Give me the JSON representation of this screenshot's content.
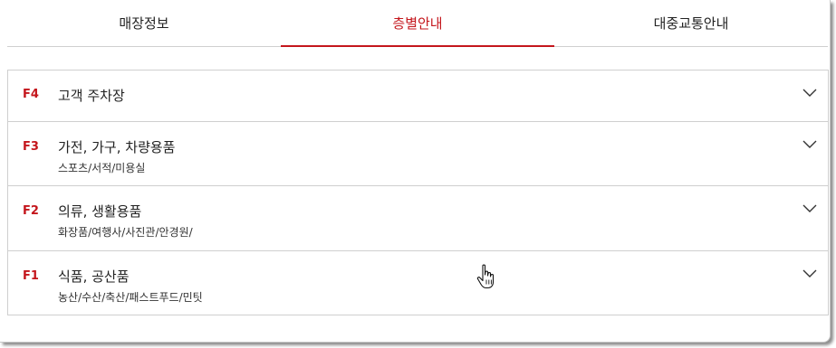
{
  "tabs": [
    {
      "label": "매장정보",
      "active": false
    },
    {
      "label": "층별안내",
      "active": true
    },
    {
      "label": "대중교통안내",
      "active": false
    }
  ],
  "accent_color": "#c4161c",
  "floors": [
    {
      "code": "F4",
      "title": "고객 주차장",
      "sub": ""
    },
    {
      "code": "F3",
      "title": "가전, 가구, 차량용품",
      "sub": "스포츠/서적/미용실"
    },
    {
      "code": "F2",
      "title": "의류, 생활용품",
      "sub": "화장품/여행사/사진관/안경원/"
    },
    {
      "code": "F1",
      "title": "식품, 공산품",
      "sub": "농산/수산/축산/패스트푸드/민팃"
    }
  ],
  "icons": {
    "expand": "chevron-down-icon",
    "pointer": "hand-cursor-icon"
  }
}
